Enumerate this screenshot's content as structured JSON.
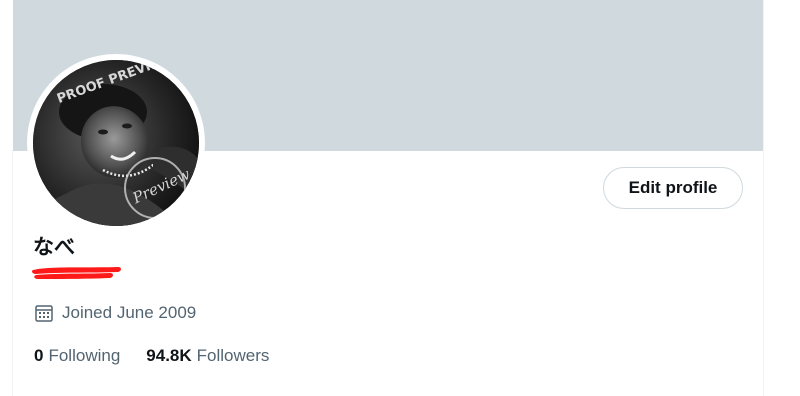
{
  "profile": {
    "display_name": "なべ",
    "edit_profile_label": "Edit profile",
    "joined_text": "Joined June 2009",
    "avatar_overlay_text": "PROOF PREVIEW",
    "avatar_stamp_text": "Preview"
  },
  "stats": {
    "following_count": "0",
    "following_label": "Following",
    "followers_count": "94.8K",
    "followers_label": "Followers"
  },
  "icons": {
    "calendar": "calendar-icon"
  },
  "colors": {
    "banner": "#cfd9de",
    "text_primary": "#0f1419",
    "text_secondary": "#536471",
    "button_border": "#cfd9de",
    "redaction": "#ff1a1a"
  }
}
